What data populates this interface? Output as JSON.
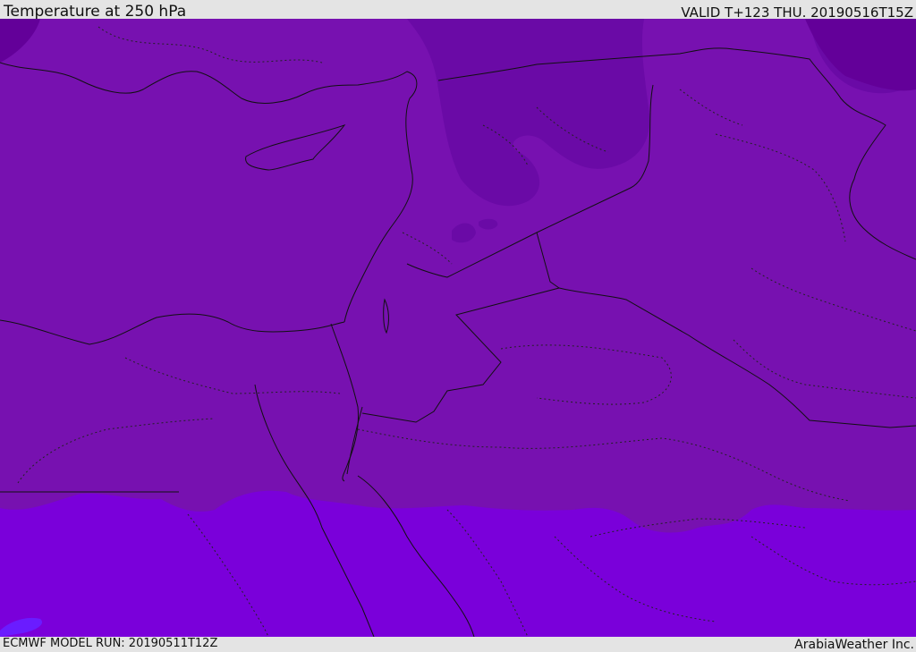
{
  "header": {
    "title": "Temperature at 250 hPa",
    "valid_time": "VALID T+123 THU. 20190516T15Z"
  },
  "footer": {
    "model_run": "ECMWF MODEL RUN: 20190511T12Z",
    "credit": "ArabiaWeather Inc."
  },
  "map": {
    "field": "temperature",
    "level": "250 hPa",
    "colors": {
      "warmest_band": "#7a00da",
      "mid_band": "#7711b0",
      "cold_band": "#6a0aa6",
      "coldest_band": "#630099",
      "blue_patch": "#6a1cff",
      "border_line": "#111111",
      "admin_line": "#222222"
    }
  }
}
